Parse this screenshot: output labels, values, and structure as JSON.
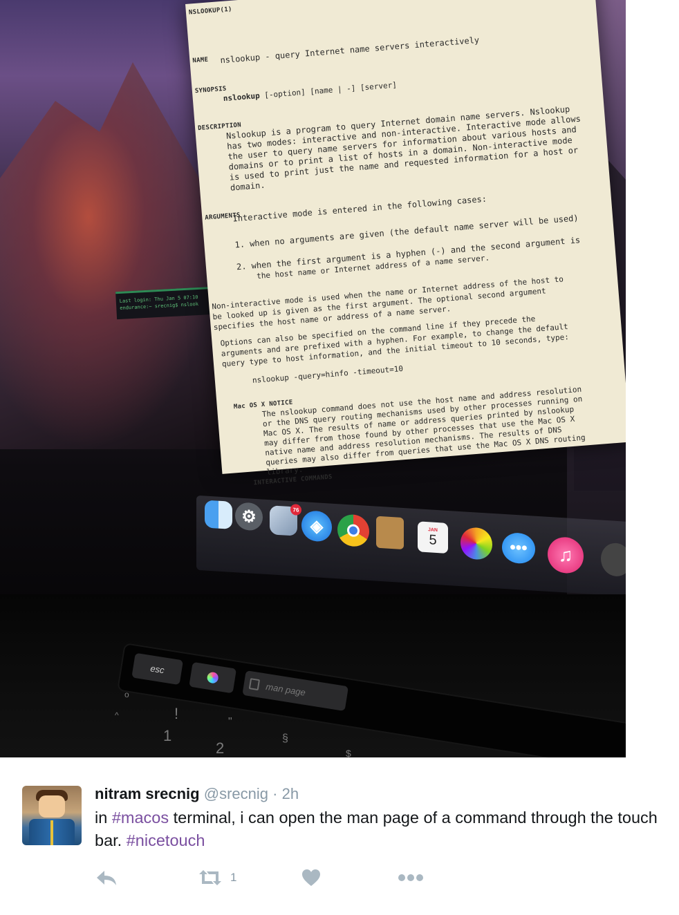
{
  "manpage": {
    "header": "NSLOOKUP(1)",
    "name_heading": "NAME",
    "name_text": "nslookup - query Internet name servers interactively",
    "synopsis_heading": "SYNOPSIS",
    "synopsis_cmd": "nslookup",
    "synopsis_args": "[-option] [name | -] [server]",
    "description_heading": "DESCRIPTION",
    "description_lines": [
      "Nslookup is a program to query Internet domain name servers.  Nslookup",
      "has two modes: interactive and non-interactive. Interactive mode allows",
      "the user to query name servers for information about various hosts and",
      "domains or to print a list of hosts in a domain. Non-interactive mode",
      "is used to print just the name and requested information for a host or",
      "domain."
    ],
    "arguments_heading": "ARGUMENTS",
    "arguments_intro": "Interactive mode is entered in the following cases:",
    "arg1": "1.  when no arguments are given (the default name server will be used)",
    "arg2a": "2.  when the first argument is a hyphen (-) and the second argument is",
    "arg2b": "the host name or Internet address of a name server.",
    "noninteractive_lines": [
      "Non-interactive mode is used when the name or Internet address of the host to",
      "be looked up is given as the first argument. The optional second argument",
      "specifies the host name or address of a name server."
    ],
    "options_lines": [
      "Options can also be specified on the command line if they precede the",
      "arguments and are prefixed with a hyphen. For example, to change the default",
      "query type to host information, and the initial timeout to 10 seconds, type:"
    ],
    "example": "nslookup -query=hinfo  -timeout=10",
    "macos_heading": "Mac OS X NOTICE",
    "macos_lines": [
      "The nslookup command does not use the host name and address resolution",
      "or the DNS query routing mechanisms used by other processes running on",
      "Mac OS X.  The results of name or address queries printed by nslookup",
      "may differ from those found by other processes that use the Mac OS X",
      "native name and address resolution mechanisms.  The results of DNS",
      "queries may also differ from queries that use the Mac OS X DNS routing",
      "library."
    ],
    "interactive_heading": "INTERACTIVE COMMANDS"
  },
  "terminal": {
    "line1": "Last login: Thu Jan  5 07:10",
    "line2": "endurance:~ srecnig$ nslook"
  },
  "dock": {
    "mail_badge": "76",
    "calendar_month": "JAN",
    "calendar_day": "5"
  },
  "touchbar": {
    "esc_label": "esc",
    "man_page_label": "man page"
  },
  "keyboard": {
    "keys": [
      "!",
      "1",
      "\"",
      "2",
      "§",
      "$"
    ]
  },
  "tweet": {
    "name": "nitram srecnig",
    "handle": "@srecnig",
    "separator": "·",
    "time": "2h",
    "text_1": "in ",
    "hashtag_1": "#macos",
    "text_2": " terminal, i can open the man page of a command through the touch bar. ",
    "hashtag_2": "#nicetouch",
    "retweet_count": "1"
  },
  "colors": {
    "hashtag": "#7a4fa0",
    "muted": "#8899a6",
    "text": "#14171a"
  }
}
